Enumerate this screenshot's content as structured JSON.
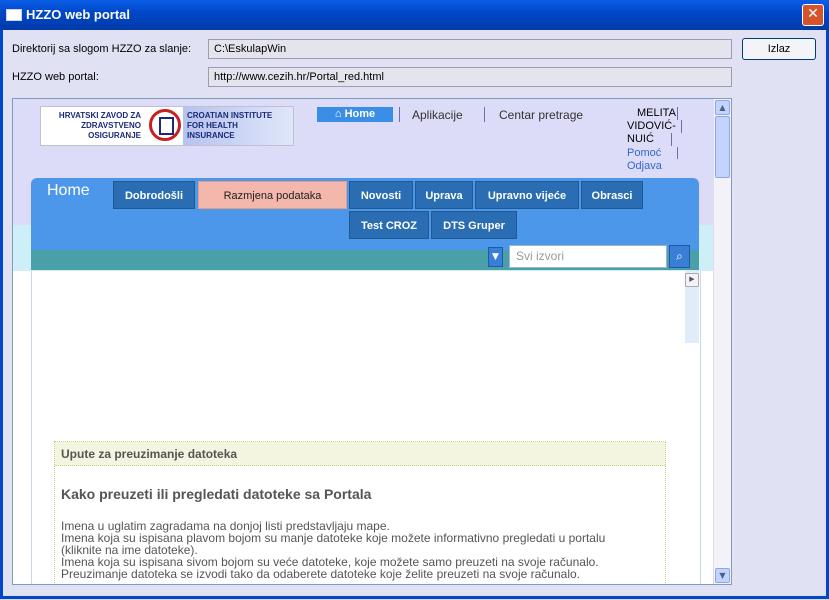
{
  "window": {
    "title": "HZZO web portal",
    "close_glyph": "✕"
  },
  "form": {
    "dir_label": "Direktorij sa slogom HZZO za slanje:",
    "dir_value": "C:\\EskulapWin",
    "portal_label": "HZZO web portal:",
    "portal_value": "http://www.cezih.hr/Portal_red.html",
    "exit_button": "Izlaz"
  },
  "portal": {
    "logo": {
      "hr_lines": [
        "HRVATSKI ZAVOD ZA",
        "ZDRAVSTVENO",
        "OSIGURANJE"
      ],
      "en_lines": [
        "CROATIAN INSTITUTE",
        "FOR HEALTH",
        "INSURANCE"
      ]
    },
    "top_nav": {
      "home": "Home",
      "apps": "Aplikacije",
      "search_center": "Centar pretrage"
    },
    "user": {
      "name_lines": [
        "MELITA",
        "VIDOVIĆ-",
        "NUIĆ"
      ],
      "help": "Pomoć",
      "logout": "Odjava"
    },
    "home_tab": "Home",
    "tabs": [
      "Dobrodošli",
      "Razmjena podataka",
      "Novosti",
      "Uprava",
      "Upravno vijeće",
      "Obrasci"
    ],
    "tabs_row2": [
      "Test CROZ",
      "DTS Gruper"
    ],
    "search": {
      "placeholder": "Svi izvori"
    },
    "panel": {
      "header": "Upute za preuzimanje datoteka",
      "heading": "Kako preuzeti ili pregledati datoteke sa Portala",
      "lines": [
        "Imena u uglatim zagradama na donjoj listi predstavljaju mape.",
        "Imena koja su ispisana plavom bojom su manje datoteke koje možete informativno pregledati u portalu",
        "(kliknite na ime datoteke).",
        "Imena koja su ispisana sivom bojom su veće datoteke, koje možete samo preuzeti na svoje računalo.",
        "Preuzimanje datoteka se izvodi tako da odaberete datoteke koje želite preuzeti na svoje računalo."
      ]
    }
  },
  "colors": {
    "title_bar": "#0047c9",
    "nav_blue": "#4c97ea",
    "tab_dark": "#2a6db2",
    "tab_active": "#f4b7ac"
  }
}
